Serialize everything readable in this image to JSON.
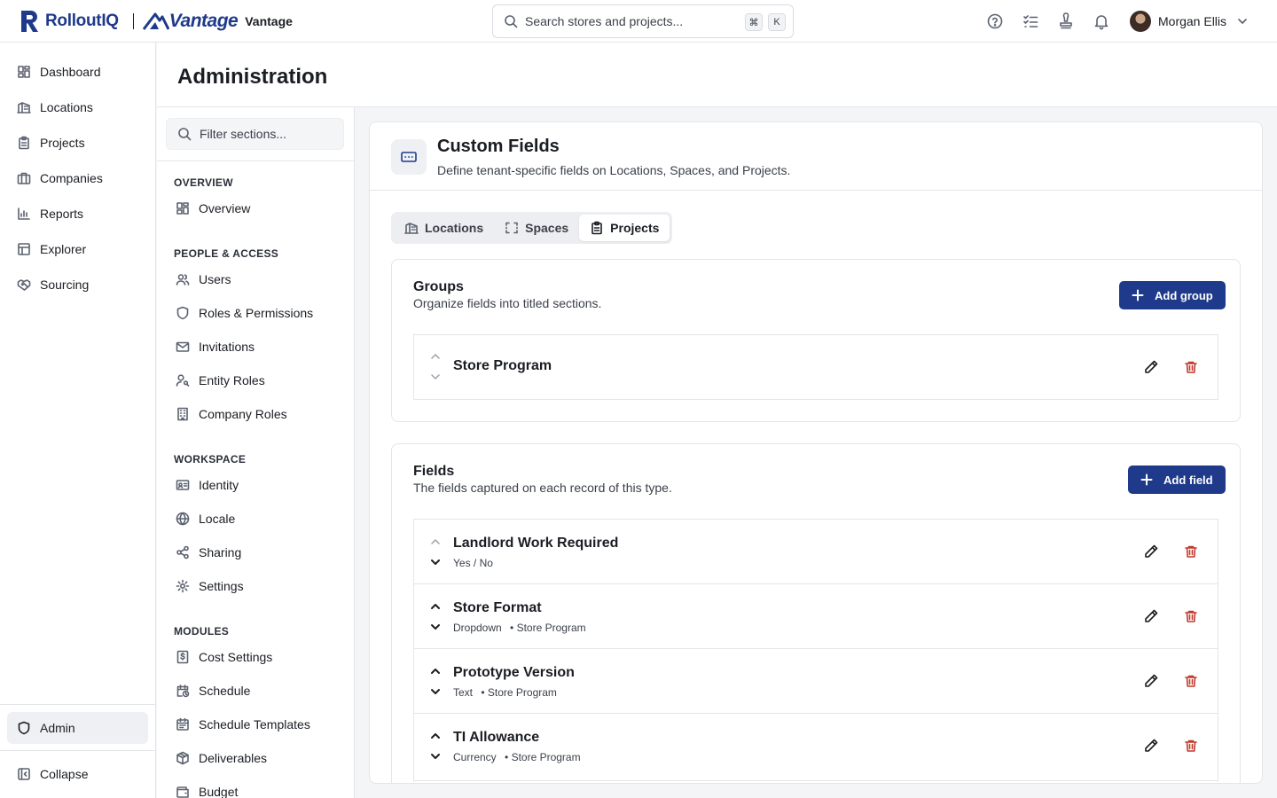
{
  "brand": {
    "name": "RolloutIQ",
    "partner_logo": "Vantage",
    "partner_name": "Vantage"
  },
  "search": {
    "placeholder": "Search stores and projects...",
    "kbd_meta": "⌘",
    "kbd_key": "K"
  },
  "header_icons": [
    "help-icon",
    "checklist-icon",
    "stamp-icon",
    "bell-icon"
  ],
  "user": {
    "name": "Morgan Ellis"
  },
  "nav": {
    "items": [
      {
        "label": "Dashboard",
        "icon": "dashboard-icon"
      },
      {
        "label": "Locations",
        "icon": "building-icon"
      },
      {
        "label": "Projects",
        "icon": "clipboard-icon"
      },
      {
        "label": "Companies",
        "icon": "briefcase-icon"
      },
      {
        "label": "Reports",
        "icon": "bar-chart-icon"
      },
      {
        "label": "Explorer",
        "icon": "table-icon"
      },
      {
        "label": "Sourcing",
        "icon": "handshake-icon"
      }
    ],
    "admin": "Admin",
    "collapse": "Collapse"
  },
  "page": {
    "title": "Administration"
  },
  "sections": {
    "filter_placeholder": "Filter sections...",
    "groups": [
      {
        "heading": "OVERVIEW",
        "items": [
          "Overview"
        ]
      },
      {
        "heading": "PEOPLE & ACCESS",
        "items": [
          "Users",
          "Roles & Permissions",
          "Invitations",
          "Entity Roles",
          "Company Roles"
        ]
      },
      {
        "heading": "WORKSPACE",
        "items": [
          "Identity",
          "Locale",
          "Sharing",
          "Settings"
        ]
      },
      {
        "heading": "MODULES",
        "items": [
          "Cost Settings",
          "Schedule",
          "Schedule Templates",
          "Deliverables",
          "Budget"
        ]
      }
    ]
  },
  "custom_fields": {
    "title": "Custom Fields",
    "subtitle": "Define tenant-specific fields on Locations, Spaces, and Projects.",
    "tabs": [
      "Locations",
      "Spaces",
      "Projects"
    ],
    "active_tab": "Projects",
    "groups": {
      "title": "Groups",
      "subtitle": "Organize fields into titled sections.",
      "add_label": "Add group",
      "rows": [
        {
          "name": "Store Program"
        }
      ]
    },
    "fields": {
      "title": "Fields",
      "subtitle": "The fields captured on each record of this type.",
      "add_label": "Add field",
      "rows": [
        {
          "name": "Landlord Work Required",
          "type": "Yes / No",
          "group": ""
        },
        {
          "name": "Store Format",
          "type": "Dropdown",
          "group": "• Store Program"
        },
        {
          "name": "Prototype Version",
          "type": "Text",
          "group": "• Store Program"
        },
        {
          "name": "TI Allowance",
          "type": "Currency",
          "group": "• Store Program"
        }
      ]
    }
  },
  "colors": {
    "primary": "#1f3a8a",
    "danger": "#c0392b"
  }
}
